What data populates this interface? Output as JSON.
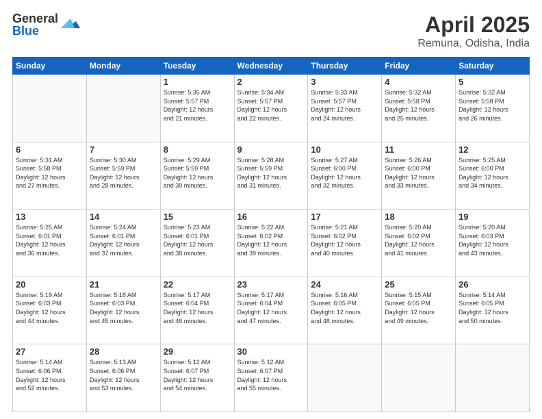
{
  "logo": {
    "general": "General",
    "blue": "Blue"
  },
  "header": {
    "month": "April 2025",
    "location": "Remuna, Odisha, India"
  },
  "weekdays": [
    "Sunday",
    "Monday",
    "Tuesday",
    "Wednesday",
    "Thursday",
    "Friday",
    "Saturday"
  ],
  "weeks": [
    [
      {
        "day": "",
        "info": ""
      },
      {
        "day": "",
        "info": ""
      },
      {
        "day": "1",
        "info": "Sunrise: 5:35 AM\nSunset: 5:57 PM\nDaylight: 12 hours\nand 21 minutes."
      },
      {
        "day": "2",
        "info": "Sunrise: 5:34 AM\nSunset: 5:57 PM\nDaylight: 12 hours\nand 22 minutes."
      },
      {
        "day": "3",
        "info": "Sunrise: 5:33 AM\nSunset: 5:57 PM\nDaylight: 12 hours\nand 24 minutes."
      },
      {
        "day": "4",
        "info": "Sunrise: 5:32 AM\nSunset: 5:58 PM\nDaylight: 12 hours\nand 25 minutes."
      },
      {
        "day": "5",
        "info": "Sunrise: 5:32 AM\nSunset: 5:58 PM\nDaylight: 12 hours\nand 26 minutes."
      }
    ],
    [
      {
        "day": "6",
        "info": "Sunrise: 5:31 AM\nSunset: 5:58 PM\nDaylight: 12 hours\nand 27 minutes."
      },
      {
        "day": "7",
        "info": "Sunrise: 5:30 AM\nSunset: 5:59 PM\nDaylight: 12 hours\nand 28 minutes."
      },
      {
        "day": "8",
        "info": "Sunrise: 5:29 AM\nSunset: 5:59 PM\nDaylight: 12 hours\nand 30 minutes."
      },
      {
        "day": "9",
        "info": "Sunrise: 5:28 AM\nSunset: 5:59 PM\nDaylight: 12 hours\nand 31 minutes."
      },
      {
        "day": "10",
        "info": "Sunrise: 5:27 AM\nSunset: 6:00 PM\nDaylight: 12 hours\nand 32 minutes."
      },
      {
        "day": "11",
        "info": "Sunrise: 5:26 AM\nSunset: 6:00 PM\nDaylight: 12 hours\nand 33 minutes."
      },
      {
        "day": "12",
        "info": "Sunrise: 5:25 AM\nSunset: 6:00 PM\nDaylight: 12 hours\nand 34 minutes."
      }
    ],
    [
      {
        "day": "13",
        "info": "Sunrise: 5:25 AM\nSunset: 6:01 PM\nDaylight: 12 hours\nand 36 minutes."
      },
      {
        "day": "14",
        "info": "Sunrise: 5:24 AM\nSunset: 6:01 PM\nDaylight: 12 hours\nand 37 minutes."
      },
      {
        "day": "15",
        "info": "Sunrise: 5:23 AM\nSunset: 6:01 PM\nDaylight: 12 hours\nand 38 minutes."
      },
      {
        "day": "16",
        "info": "Sunrise: 5:22 AM\nSunset: 6:02 PM\nDaylight: 12 hours\nand 39 minutes."
      },
      {
        "day": "17",
        "info": "Sunrise: 5:21 AM\nSunset: 6:02 PM\nDaylight: 12 hours\nand 40 minutes."
      },
      {
        "day": "18",
        "info": "Sunrise: 5:20 AM\nSunset: 6:02 PM\nDaylight: 12 hours\nand 41 minutes."
      },
      {
        "day": "19",
        "info": "Sunrise: 5:20 AM\nSunset: 6:03 PM\nDaylight: 12 hours\nand 43 minutes."
      }
    ],
    [
      {
        "day": "20",
        "info": "Sunrise: 5:19 AM\nSunset: 6:03 PM\nDaylight: 12 hours\nand 44 minutes."
      },
      {
        "day": "21",
        "info": "Sunrise: 5:18 AM\nSunset: 6:03 PM\nDaylight: 12 hours\nand 45 minutes."
      },
      {
        "day": "22",
        "info": "Sunrise: 5:17 AM\nSunset: 6:04 PM\nDaylight: 12 hours\nand 46 minutes."
      },
      {
        "day": "23",
        "info": "Sunrise: 5:17 AM\nSunset: 6:04 PM\nDaylight: 12 hours\nand 47 minutes."
      },
      {
        "day": "24",
        "info": "Sunrise: 5:16 AM\nSunset: 6:05 PM\nDaylight: 12 hours\nand 48 minutes."
      },
      {
        "day": "25",
        "info": "Sunrise: 5:15 AM\nSunset: 6:05 PM\nDaylight: 12 hours\nand 49 minutes."
      },
      {
        "day": "26",
        "info": "Sunrise: 5:14 AM\nSunset: 6:05 PM\nDaylight: 12 hours\nand 50 minutes."
      }
    ],
    [
      {
        "day": "27",
        "info": "Sunrise: 5:14 AM\nSunset: 6:06 PM\nDaylight: 12 hours\nand 52 minutes."
      },
      {
        "day": "28",
        "info": "Sunrise: 5:13 AM\nSunset: 6:06 PM\nDaylight: 12 hours\nand 53 minutes."
      },
      {
        "day": "29",
        "info": "Sunrise: 5:12 AM\nSunset: 6:07 PM\nDaylight: 12 hours\nand 54 minutes."
      },
      {
        "day": "30",
        "info": "Sunrise: 5:12 AM\nSunset: 6:07 PM\nDaylight: 12 hours\nand 55 minutes."
      },
      {
        "day": "",
        "info": ""
      },
      {
        "day": "",
        "info": ""
      },
      {
        "day": "",
        "info": ""
      }
    ]
  ]
}
